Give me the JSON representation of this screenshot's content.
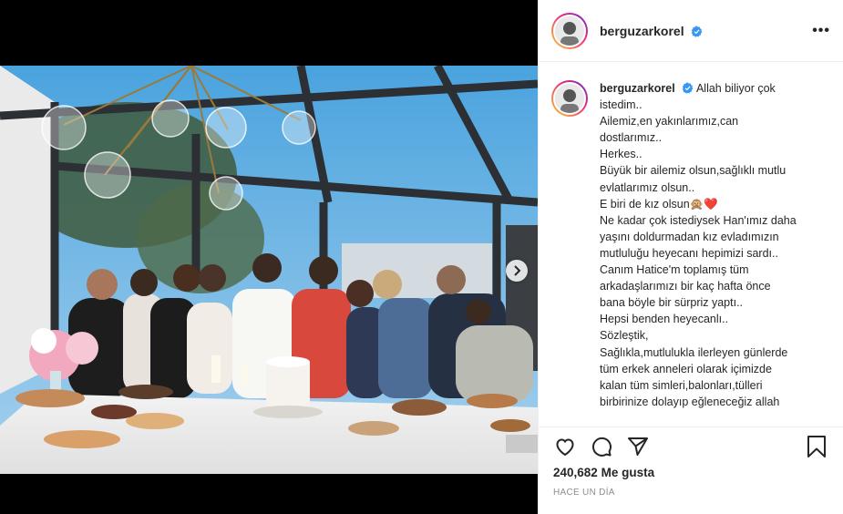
{
  "post": {
    "username": "berguzarkorel",
    "verified": true,
    "more_label": "•••",
    "caption_lines": [
      "Allah biliyor çok",
      "istedim..",
      "Ailemiz,en yakınlarımız,can",
      "dostlarımız..",
      "Herkes..",
      "Büyük bir ailemiz olsun,sağlıklı mutlu",
      "evlatlarımız olsun..",
      "E biri de kız olsun🙊❤️",
      "Ne kadar çok istediysek Han'ımız daha",
      "yaşını doldurmadan kız evladımızın",
      "mutluluğu heyecanı hepimizi sardı..",
      "Canım Hatice'm toplamış tüm",
      "arkadaşlarımızı bir kaç hafta önce",
      "bana böyle bir sürpriz yaptı..",
      "Hepsi benden heyecanlı..",
      "Sözleştik,",
      "Sağlıkla,mutlulukla ilerleyen günlerde",
      "tüm erkek anneleri olarak içimizde",
      "kalan tüm simleri,balonları,tülleri",
      "birbirinize dolayıp eğleneceğiz allah"
    ],
    "likes_count": "240,682",
    "likes_label": "Me gusta",
    "time_label": "HACE UN DÍA"
  },
  "icons": {
    "verified": "verified-badge-icon",
    "like": "heart-icon",
    "comment": "comment-icon",
    "share": "paper-plane-icon",
    "save": "bookmark-icon",
    "next": "chevron-right-icon"
  },
  "colors": {
    "verified_blue": "#3897f0",
    "text": "#262626",
    "muted": "#8e8e8e",
    "border": "#efefef"
  }
}
